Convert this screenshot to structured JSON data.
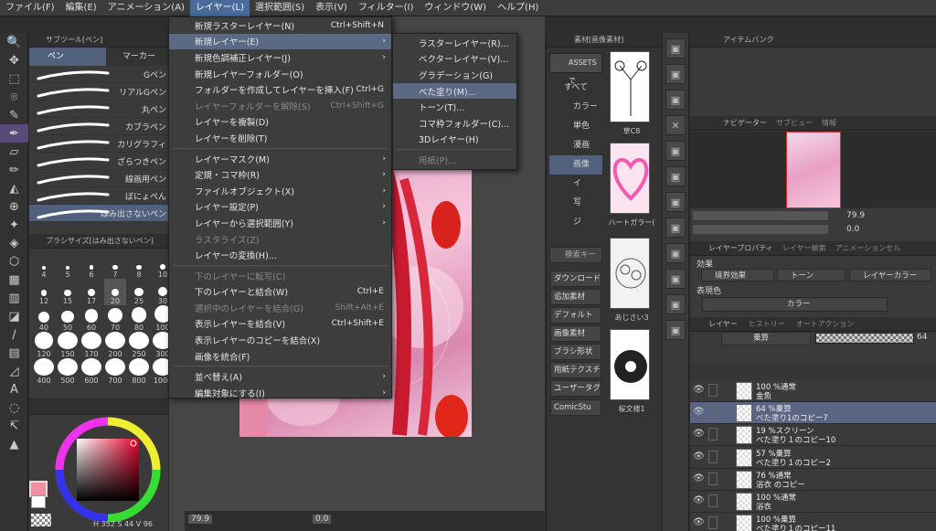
{
  "menubar": [
    "ファイル(F)",
    "編集(E)",
    "アニメーション(A)",
    "レイヤー(L)",
    "選択範囲(S)",
    "表示(V)",
    "フィルター(I)",
    "ウィンドウ(W)",
    "ヘルプ(H)"
  ],
  "subtool": {
    "header": "サブツール[ペン]",
    "tabs": [
      "ペン",
      "マーカー"
    ],
    "brushes": [
      "Gペン",
      "リアルGペン",
      "丸ペン",
      "カブラペン",
      "カリグラフィ",
      "ざらつきペン",
      "線画用ペン",
      "ぼにょぺん",
      "はみ出さないペン"
    ]
  },
  "brushsize": {
    "header": "ブラシサイズ[はみ出さないペン]",
    "sizes": [
      "4",
      "5",
      "6",
      "7",
      "8",
      "10",
      "12",
      "15",
      "17",
      "20",
      "25",
      "30",
      "40",
      "50",
      "60",
      "70",
      "80",
      "100",
      "120",
      "150",
      "170",
      "200",
      "250",
      "300",
      "400",
      "500",
      "600",
      "700",
      "800",
      "1000"
    ],
    "selected": "20"
  },
  "color": {
    "readout": "H 352  S 44  V 96"
  },
  "layer_menu": {
    "items": [
      {
        "label": "新規ラスターレイヤー(N)",
        "shortcut": "Ctrl+Shift+N"
      },
      {
        "label": "新規レイヤー(E)",
        "arrow": true,
        "hl": true
      },
      {
        "label": "新規色調補正レイヤー(J)",
        "arrow": true
      },
      {
        "label": "新規レイヤーフォルダー(O)"
      },
      {
        "label": "フォルダーを作成してレイヤーを挿入(F)",
        "shortcut": "Ctrl+G"
      },
      {
        "label": "レイヤーフォルダーを解除(S)",
        "shortcut": "Ctrl+Shift+G",
        "dis": true
      },
      {
        "label": "レイヤーを複製(D)"
      },
      {
        "label": "レイヤーを削除(T)"
      },
      {
        "sep": true
      },
      {
        "label": "レイヤーマスク(M)",
        "arrow": true
      },
      {
        "label": "定規・コマ枠(R)",
        "arrow": true
      },
      {
        "label": "ファイルオブジェクト(X)",
        "arrow": true
      },
      {
        "label": "レイヤー設定(P)",
        "arrow": true
      },
      {
        "label": "レイヤーから選択範囲(Y)",
        "arrow": true
      },
      {
        "label": "ラスタライズ(Z)",
        "dis": true
      },
      {
        "label": "レイヤーの変換(H)..."
      },
      {
        "sep": true
      },
      {
        "label": "下のレイヤーに転写(C)",
        "dis": true
      },
      {
        "label": "下のレイヤーと結合(W)",
        "shortcut": "Ctrl+E"
      },
      {
        "label": "選択中のレイヤーを結合(G)",
        "shortcut": "Shift+Alt+E",
        "dis": true
      },
      {
        "label": "表示レイヤーを結合(V)",
        "shortcut": "Ctrl+Shift+E"
      },
      {
        "label": "表示レイヤーのコピーを結合(X)"
      },
      {
        "label": "画像を統合(F)"
      },
      {
        "sep": true
      },
      {
        "label": "並べ替え(A)",
        "arrow": true
      },
      {
        "label": "編集対象にする(I)",
        "arrow": true
      }
    ]
  },
  "new_layer_submenu": [
    {
      "label": "ラスターレイヤー(R)..."
    },
    {
      "label": "ベクターレイヤー(V)..."
    },
    {
      "label": "グラデーション(G)"
    },
    {
      "label": "べた塗り(M)...",
      "hl": true
    },
    {
      "label": "トーン(T)..."
    },
    {
      "label": "コマ枠フォルダー(C)..."
    },
    {
      "label": "3Dレイヤー(H)"
    },
    {
      "sep": true
    },
    {
      "label": "用紙(P)...",
      "dis": true
    }
  ],
  "materials": {
    "header": "素材[画像素材]",
    "assets": "ASSETSで",
    "tree": [
      "すべて",
      "カラー",
      "単色",
      "漫画",
      "画像",
      "イ",
      "写",
      "ジ"
    ],
    "thumb_captions": [
      "草C8",
      "ハートガラー(",
      "あじさい3",
      "桜文様1"
    ],
    "search": "検索キー",
    "buttons": [
      "ダウンロード",
      "追加素材",
      "デフォルト",
      "画像素材",
      "ブラシ形状",
      "用紙テクスチャ",
      "ユーザータグ",
      "ComicStu"
    ]
  },
  "right": {
    "itembank": "アイテムバンク",
    "navigator_tabs": [
      "ナビゲーター",
      "サブビュー",
      "情報"
    ],
    "zoom": "79.9",
    "angle": "0.0",
    "props_tabs": [
      "レイヤープロパティ",
      "レイヤー検索",
      "アニメーションセル"
    ],
    "effect_label": "効果",
    "effects": [
      "境界効果",
      "トーン",
      "レイヤーカラー"
    ],
    "expr_label": "表現色",
    "expr_value": "カラー",
    "layer_tabs": [
      "レイヤー",
      "ヒストリー",
      "オートアクション"
    ],
    "blend": "乗算",
    "opacity": "64",
    "layers": [
      {
        "l1": "100 %通常",
        "l2": "金魚"
      },
      {
        "l1": "64 %乗算",
        "l2": "べた塗り1のコピー7",
        "sel": true
      },
      {
        "l1": "19 %スクリーン",
        "l2": "べた塗り１のコピー10"
      },
      {
        "l1": "57 %乗算",
        "l2": "べた塗り１のコピー2"
      },
      {
        "l1": "76 %通常",
        "l2": "浴衣 のコピー"
      },
      {
        "l1": "100 %通常",
        "l2": "浴衣"
      },
      {
        "l1": "100 %乗算",
        "l2": "べた塗り１のコピー11"
      }
    ]
  },
  "canvas_status": {
    "zoom": "79.9",
    "angle": "0.0"
  },
  "colors": {
    "accent": "#4a6b99",
    "selected_row": "#5a6483",
    "brush_selected": "#50607d",
    "main_color": "#f08fa0"
  }
}
